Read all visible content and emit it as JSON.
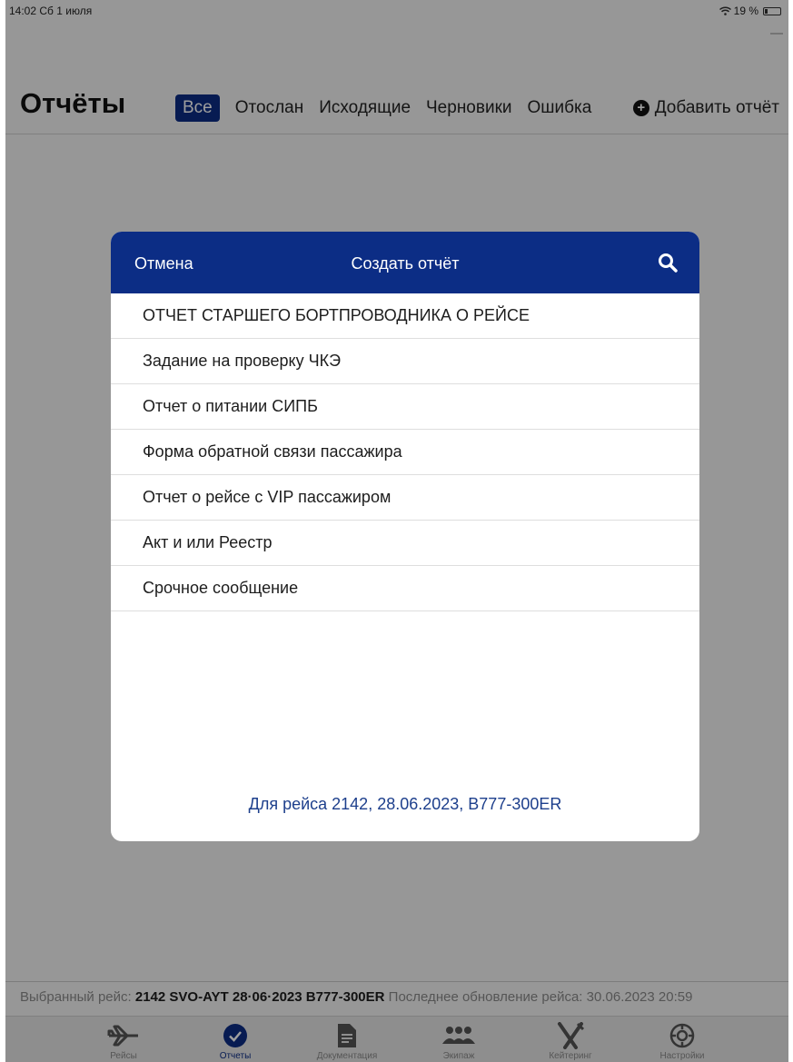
{
  "status_bar": {
    "time": "14:02",
    "date": "Сб 1 июля",
    "battery": "19 %"
  },
  "header": {
    "title": "Отчёты",
    "tabs": [
      {
        "label": "Все",
        "active": true
      },
      {
        "label": "Отослан",
        "active": false
      },
      {
        "label": "Исходящие",
        "active": false
      },
      {
        "label": "Черновики",
        "active": false
      },
      {
        "label": "Ошибка",
        "active": false
      }
    ],
    "add_report_label": "Добавить отчёт"
  },
  "modal": {
    "cancel_label": "Отмена",
    "title": "Создать отчёт",
    "items": [
      {
        "label": "ОТЧЕТ СТАРШЕГО БОРТПРОВОДНИКА О РЕЙСЕ"
      },
      {
        "label": "Задание на проверку ЧКЭ"
      },
      {
        "label": "Отчет о питании СИПБ"
      },
      {
        "label": "Форма обратной связи пассажира"
      },
      {
        "label": "Отчет о рейсе с VIP пассажиром"
      },
      {
        "label": "Акт и или Реестр"
      },
      {
        "label": "Срочное сообщение"
      }
    ],
    "flight_info": "Для рейса 2142, 28.06.2023, B777-300ER"
  },
  "info_bar": {
    "selected_label": "Выбранный рейс:",
    "selected_value": "2142 SVO-AYT 28·06·2023 B777-300ER",
    "updated_label": "Последнее обновление рейса:",
    "updated_value": "30.06.2023 20:59"
  },
  "tab_bar": [
    {
      "label": "Рейсы",
      "icon": "plane-icon",
      "active": false
    },
    {
      "label": "Отчеты",
      "icon": "check-circle-icon",
      "active": true
    },
    {
      "label": "Документация",
      "icon": "document-icon",
      "active": false
    },
    {
      "label": "Экипаж",
      "icon": "crew-icon",
      "active": false
    },
    {
      "label": "Кейтеринг",
      "icon": "cutlery-icon",
      "active": false
    },
    {
      "label": "Настройки",
      "icon": "settings-icon",
      "active": false
    }
  ],
  "colors": {
    "brand": "#0c2d85",
    "link": "#1d3f8c"
  }
}
